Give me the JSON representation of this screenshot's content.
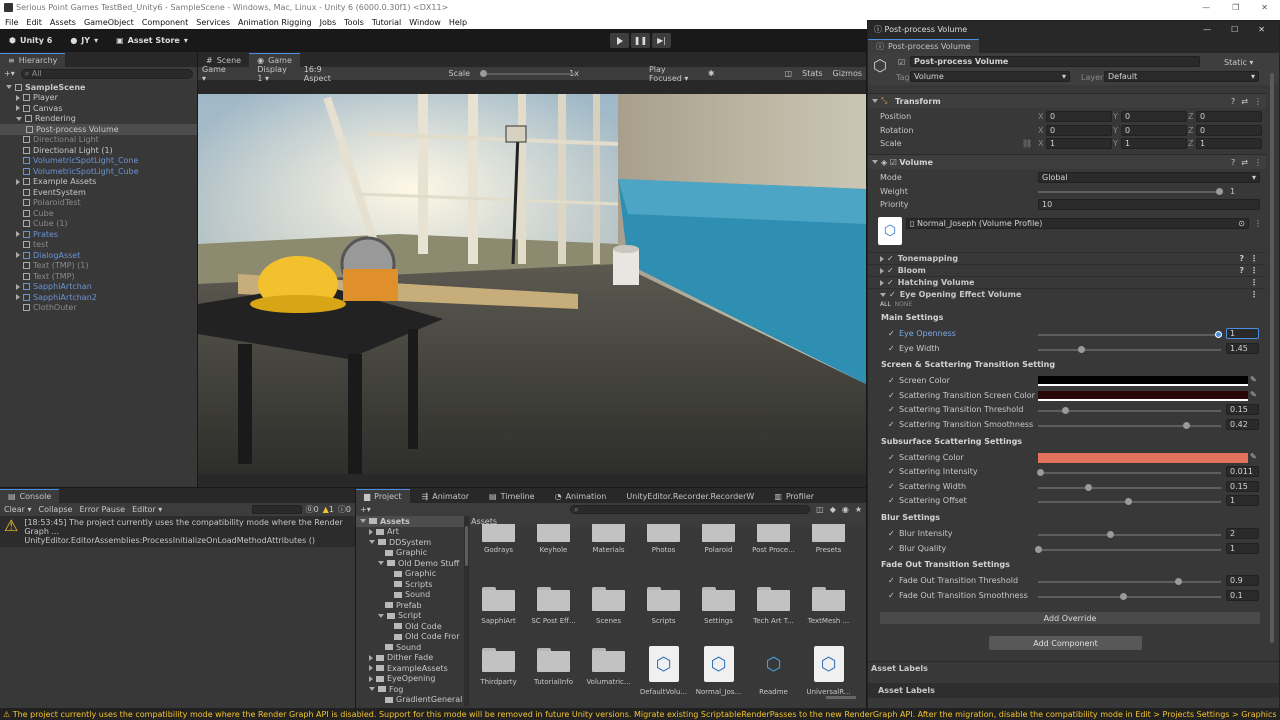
{
  "window": {
    "title": "Serious Point Games TestBed_Unity6 - SampleScene - Windows, Mac, Linux - Unity 6 (6000.0.30f1) <DX11>"
  },
  "menu": [
    "File",
    "Edit",
    "Assets",
    "GameObject",
    "Component",
    "Services",
    "Animation Rigging",
    "Jobs",
    "Tools",
    "Tutorial",
    "Window",
    "Help"
  ],
  "toolbar": {
    "unity_label": "Unity 6",
    "account": "JY",
    "asset_store": "Asset Store"
  },
  "hierarchy": {
    "tab": "Hierarchy",
    "search_placeholder": "All",
    "items": [
      {
        "label": "SampleScene",
        "indent": 0,
        "style": "bold"
      },
      {
        "label": "Player",
        "indent": 1
      },
      {
        "label": "Canvas",
        "indent": 1
      },
      {
        "label": "Rendering",
        "indent": 1
      },
      {
        "label": "Post-process Volume",
        "indent": 2,
        "style": "selected"
      },
      {
        "label": "Directional Light",
        "indent": 1,
        "style": "dim"
      },
      {
        "label": "Directional Light (1)",
        "indent": 1
      },
      {
        "label": "VolumetricSpotLight_Cone",
        "indent": 1,
        "style": "blue-dim"
      },
      {
        "label": "VolumetricSpotLight_Cube",
        "indent": 1,
        "style": "blue-dim"
      },
      {
        "label": "Example Assets",
        "indent": 1
      },
      {
        "label": "EventSystem",
        "indent": 1
      },
      {
        "label": "PolaroidTest",
        "indent": 1,
        "style": "dim"
      },
      {
        "label": "Cube",
        "indent": 1,
        "style": "dim"
      },
      {
        "label": "Cube (1)",
        "indent": 1,
        "style": "dim"
      },
      {
        "label": "Prates",
        "indent": 1,
        "style": "blue-dim"
      },
      {
        "label": "test",
        "indent": 1,
        "style": "dim"
      },
      {
        "label": "DialogAsset",
        "indent": 1,
        "style": "blue-dim"
      },
      {
        "label": "Text (TMP) (1)",
        "indent": 1,
        "style": "dim"
      },
      {
        "label": "Text (TMP)",
        "indent": 1,
        "style": "dim"
      },
      {
        "label": "SapphiArtchan",
        "indent": 1,
        "style": "blue-dim"
      },
      {
        "label": "SapphiArtchan2",
        "indent": 1,
        "style": "blue-dim"
      },
      {
        "label": "ClothOuter",
        "indent": 1,
        "style": "dim"
      }
    ]
  },
  "scene_tabs": {
    "scene": "Scene",
    "game": "Game"
  },
  "game_bar": {
    "display_mode": "Game",
    "display": "Display 1",
    "aspect": "16:9 Aspect",
    "scale_label": "Scale",
    "scale_value": "1x",
    "play_focused": "Play Focused",
    "stats": "Stats",
    "gizmos": "Gizmos"
  },
  "console": {
    "tab": "Console",
    "clear": "Clear",
    "collapse": "Collapse",
    "error_pause": "Error Pause",
    "editor": "Editor",
    "counts": {
      "errors": "0",
      "warnings": "1",
      "logs": "0"
    },
    "message_line1": "[18:53:45] The project currently uses the compatibility mode where the Render Graph ...",
    "message_line2": "UnityEditor.EditorAssemblies:ProcessInitializeOnLoadMethodAttributes ()"
  },
  "project": {
    "tabs": [
      "Project",
      "Animator",
      "Timeline",
      "Animation",
      "UnityEditor.Recorder.RecorderW",
      "Profiler"
    ],
    "tree": [
      {
        "label": "Assets",
        "indent": 0,
        "style": "bold"
      },
      {
        "label": "Art",
        "indent": 1
      },
      {
        "label": "DDSystem",
        "indent": 1
      },
      {
        "label": "Graphic",
        "indent": 2
      },
      {
        "label": "Old Demo Stuff",
        "indent": 2
      },
      {
        "label": "Graphic",
        "indent": 3
      },
      {
        "label": "Scripts",
        "indent": 3
      },
      {
        "label": "Sound",
        "indent": 3
      },
      {
        "label": "Prefab",
        "indent": 2
      },
      {
        "label": "Script",
        "indent": 2
      },
      {
        "label": "Old Code",
        "indent": 3
      },
      {
        "label": "Old Code Fror",
        "indent": 3
      },
      {
        "label": "Sound",
        "indent": 2
      },
      {
        "label": "Dither Fade",
        "indent": 1
      },
      {
        "label": "ExampleAssets",
        "indent": 1
      },
      {
        "label": "EyeOpening",
        "indent": 1
      },
      {
        "label": "Fog",
        "indent": 1
      },
      {
        "label": "GradientGeneral",
        "indent": 2
      }
    ],
    "breadcrumb": "Assets",
    "grid_row1": [
      "Godrays",
      "Keyhole",
      "Materials",
      "Photos",
      "Polaroid",
      "Post Proce...",
      "Presets"
    ],
    "grid_row2": [
      "SapphiArt",
      "SC Post Eff...",
      "Scenes",
      "Scripts",
      "Settings",
      "Tech Art T...",
      "TextMesh ..."
    ],
    "grid_row3": [
      "Thirdparty",
      "TutorialInfo",
      "Volumatric...",
      "DefaultVolu...",
      "Normal_Jos...",
      "Readme",
      "UniversalR..."
    ]
  },
  "inspector": {
    "window_title": "Post-process Volume",
    "tab": "Post-process Volume",
    "object_name": "Post-process Volume",
    "static_label": "Static",
    "tag_label": "Tag",
    "tag_value": "Volume",
    "layer_label": "Layer",
    "layer_value": "Default",
    "transform": {
      "title": "Transform",
      "position_label": "Position",
      "rotation_label": "Rotation",
      "scale_label": "Scale",
      "position": [
        "0",
        "0",
        "0"
      ],
      "rotation": [
        "0",
        "0",
        "0"
      ],
      "scale": [
        "1",
        "1",
        "1"
      ]
    },
    "volume": {
      "title": "Volume",
      "mode_label": "Mode",
      "mode_value": "Global",
      "weight_label": "Weight",
      "weight_value": "1",
      "weight_fraction": 1.0,
      "priority_label": "Priority",
      "priority_value": "10",
      "profile": "Normal_Joseph (Volume Profile)"
    },
    "overrides": [
      "Tonemapping",
      "Bloom",
      "Hatching Volume",
      "Eye Opening Effect Volume"
    ],
    "all_label": "ALL",
    "none_label": "NONE",
    "main_settings": {
      "title": "Main Settings",
      "rows": [
        {
          "label": "Eye Openness",
          "value": "1",
          "fraction": 1.0,
          "highlight": true
        },
        {
          "label": "Eye Width",
          "value": "1.45",
          "fraction": 0.24
        }
      ]
    },
    "screen_settings": {
      "title": "Screen & Scattering Transition Setting",
      "screen_color_label": "Screen Color",
      "transition_color_label": "Scattering Transition Screen Color",
      "rows": [
        {
          "label": "Scattering Transition Threshold",
          "value": "0.15",
          "fraction": 0.15
        },
        {
          "label": "Scattering Transition Smoothness",
          "value": "0.42",
          "fraction": 0.82
        }
      ]
    },
    "subsurface": {
      "title": "Subsurface Scattering Settings",
      "color_label": "Scattering Color",
      "color_value": "#e2725e",
      "rows": [
        {
          "label": "Scattering Intensity",
          "value": "0.011",
          "fraction": 0.01
        },
        {
          "label": "Scattering Width",
          "value": "0.15",
          "fraction": 0.28
        },
        {
          "label": "Scattering Offset",
          "value": "1",
          "fraction": 0.5
        }
      ]
    },
    "blur": {
      "title": "Blur Settings",
      "rows": [
        {
          "label": "Blur Intensity",
          "value": "2",
          "fraction": 0.4
        },
        {
          "label": "Blur Quality",
          "value": "1",
          "fraction": 0.0
        }
      ]
    },
    "fade": {
      "title": "Fade Out Transition Settings",
      "rows": [
        {
          "label": "Fade Out Transition Threshold",
          "value": "0.9",
          "fraction": 0.78
        },
        {
          "label": "Fade Out Transition Smoothness",
          "value": "0.1",
          "fraction": 0.47
        }
      ]
    },
    "add_override": "Add Override",
    "add_component": "Add Component",
    "asset_labels_1": "Asset Labels",
    "asset_labels_2": "Asset Labels"
  },
  "statusbar": {
    "message": "The project currently uses the compatibility mode where the Render Graph API is disabled. Support for this mode will be removed in future Unity versions. Migrate existing ScriptableRenderPasses to the new RenderGraph API. After the migration, disable the compatibility mode in Edit > Projects Settings > Graphics > |"
  },
  "colors": {
    "accent": "#4a8ee0",
    "selection": "#2c5d87",
    "warning": "#f4c430"
  }
}
